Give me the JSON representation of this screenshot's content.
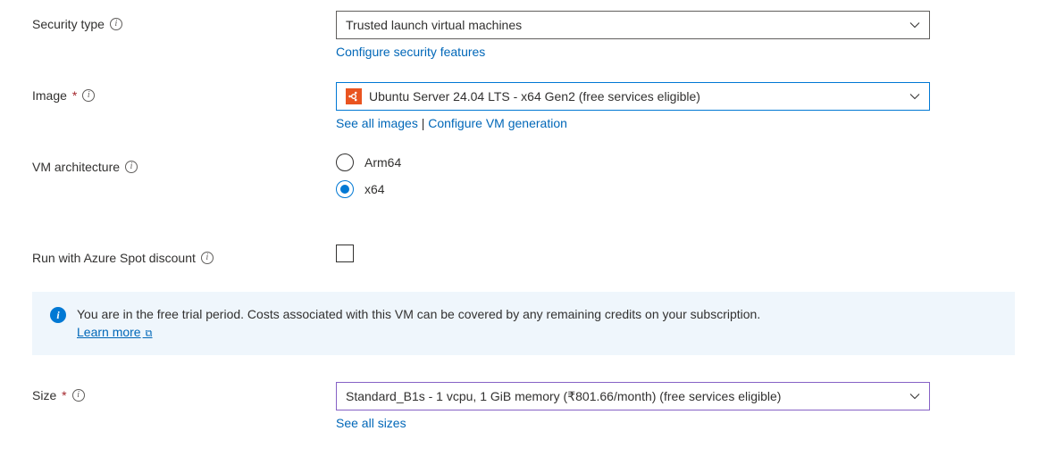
{
  "security_type": {
    "label": "Security type",
    "value": "Trusted launch virtual machines",
    "link": "Configure security features"
  },
  "image": {
    "label": "Image",
    "value": "Ubuntu Server 24.04 LTS - x64 Gen2 (free services eligible)",
    "link1": "See all images",
    "link2": "Configure VM generation"
  },
  "vm_arch": {
    "label": "VM architecture",
    "options": [
      {
        "label": "Arm64",
        "selected": false
      },
      {
        "label": "x64",
        "selected": true
      }
    ]
  },
  "spot": {
    "label": "Run with Azure Spot discount",
    "checked": false
  },
  "banner": {
    "text": "You are in the free trial period. Costs associated with this VM can be covered by any remaining credits on your subscription.",
    "learn_more": "Learn more"
  },
  "size": {
    "label": "Size",
    "value": "Standard_B1s - 1 vcpu, 1 GiB memory (₹801.66/month) (free services eligible)",
    "link": "See all sizes"
  }
}
